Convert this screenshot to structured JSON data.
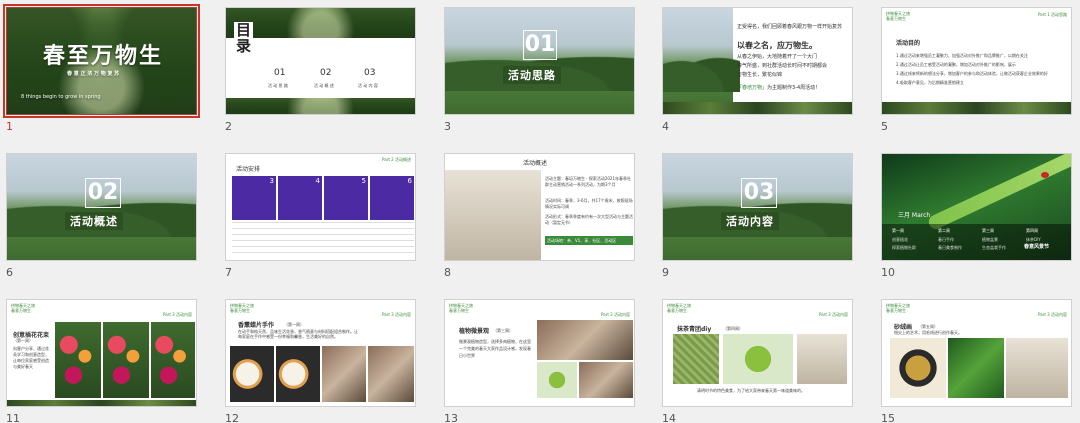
{
  "slides": [
    {
      "num": "1",
      "title": "春至万物生",
      "subtitle": "春 意 正 浓 万 物 复 苏",
      "caption": "8 things begin to grow in spring",
      "selected": true
    },
    {
      "num": "2",
      "title_a": "目",
      "title_b": "录",
      "items": [
        {
          "n": "01",
          "label": "活 动 思 路"
        },
        {
          "n": "02",
          "label": "活 动 概 述"
        },
        {
          "n": "03",
          "label": "活 动 内 容"
        }
      ]
    },
    {
      "num": "3",
      "big": "01",
      "banner": "活动思路"
    },
    {
      "num": "4",
      "heading": "以春之名，应万物生。",
      "quote": "「春培万物」",
      "para1": "正受得名，我们回顾着春风跟万物一样开始复苏",
      "para2": "从春之伊始，大地随着开了一个大门",
      "para3": "春气所盛，到社群活动长时间不时期都会",
      "para4": "万物生长，繁花似锦",
      "para5": "为主题制作3-4周活动！"
    },
    {
      "num": "5",
      "tag1": "拼物春天之旅",
      "tag2": "春意万物生",
      "part": "Part 1 活动思路",
      "heading": "活动目的",
      "l1": "1.通过活动来增强员工凝聚力，加强活动对外推广和品牌推广，以期在关注",
      "l2": "2.通过活动让员工感受活动的凝聚，增加活动对外推广的影响，展示",
      "l3": "3.通过线来将新的想法分享，增加客户的参与和活动体验，让做活动获客企业效果的好",
      "l4": "4.吸取客户意见，为后期精准营销建立"
    },
    {
      "num": "6",
      "big": "02",
      "banner": "活动概述"
    },
    {
      "num": "7",
      "title": "活动安排",
      "part": "Part 2 活动概述",
      "months": [
        "3",
        "4",
        "5",
        "6"
      ]
    },
    {
      "num": "8",
      "title": "活动概述",
      "line1": "活动主题：春培万物生 · 探索活动2021年春季社群主动营销活动一系列活动，为期3个月",
      "line2": "活动时间：春季，3-6月，共17个周末，按照现场情况实际可调",
      "line3": "活动形式：春季季度有约有一次大型活动与主题活动（暂定无节）",
      "footer": "活动场地：亲、V1、享、社区、活动区"
    },
    {
      "num": "9",
      "big": "03",
      "banner": "活动内容"
    },
    {
      "num": "10",
      "month": "三月 March",
      "weeks": [
        "第一周",
        "第二周",
        "第三周",
        "第四周"
      ],
      "acts": [
        "创意插花",
        "春日手作",
        "植物盆景",
        "抹茶DIY"
      ],
      "sub": [
        "探索植物社群",
        "春日美食制作",
        "生态盆栽手作"
      ],
      "badge": "春意风景节"
    },
    {
      "num": "11",
      "tag1": "拼物春天之旅",
      "tag2": "春意万物生",
      "part": "Part 3 活动内容",
      "title": "创意插花花束",
      "week": "（第一周）",
      "desc": "向客户分享、通过花朵学习和创意造型，让每位家庭感受创造与美好春天"
    },
    {
      "num": "12",
      "tag1": "拼物春天之旅",
      "tag2": "春意万物生",
      "part": "Part 3 活动内容",
      "title": "香薰蜡片手作",
      "week": "（第一周）",
      "desc": "在动手和纯天然、品味生活花香，香气随意与材料搭配组合制作。让每家庭在手作中感受一份幸福和馨香，生活美好的自然。"
    },
    {
      "num": "13",
      "tag1": "拼物春天之旅",
      "tag2": "春意万物生",
      "part": "Part 3 活动内容",
      "title": "植物微景观",
      "week": "（第三周）",
      "desc": "微景观植物造型，选择多肉植物、在这里一个完美的春天大家作品设计感，发现春日小世界"
    },
    {
      "num": "14",
      "tag1": "拼物春天之旅",
      "tag2": "春意万物生",
      "part": "Part 3 活动内容",
      "title": "抹茶青团diy",
      "week": "（第四周）",
      "desc": "清明时节的特色美食，为了给大家带来春天第一味道美味的。"
    },
    {
      "num": "15",
      "tag1": "拼物春天之旅",
      "tag2": "春意万物生",
      "part": "Part 3 活动内容",
      "title": "砂绒画",
      "week": "（第五周）",
      "desc": "指尖上的艺术，用毛线进行创作春天。"
    }
  ]
}
